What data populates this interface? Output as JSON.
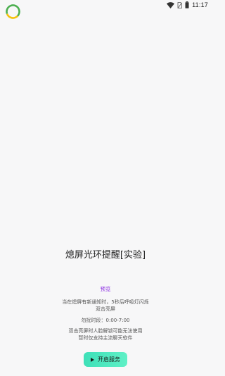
{
  "status_bar": {
    "time": "11:17",
    "icons": [
      "wifi-icon",
      "sim-no-signal-icon",
      "battery-icon"
    ]
  },
  "app_icon": "ring-icon",
  "main": {
    "title": "熄屏光环提醒[实验]",
    "preview_label": "预览",
    "desc_line1": "当在熄屏有新通知时，5秒后呼吸灯闪烁",
    "desc_line2": "双击亮屏",
    "dnd_label": "勿扰时段：0:00-7:00",
    "note_line1": "双击亮屏时人脸解锁可能无法使用",
    "note_line2": "暂时仅支持主流聊天软件",
    "start_button_label": "开启服务"
  },
  "colors": {
    "background": "#f7f7f8",
    "accent_link": "#8a2be2",
    "button_gradient_start": "#3ee0b8",
    "button_gradient_end": "#5ff0c6",
    "ring_green": "#4caf50",
    "ring_yellow": "#f4c20d"
  }
}
